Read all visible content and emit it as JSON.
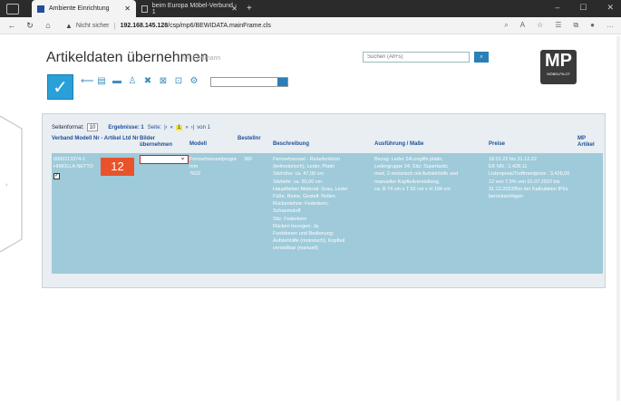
{
  "browser": {
    "tabs": [
      {
        "label": "Ambiente Einrichtung"
      },
      {
        "label": "beim Europa Möbel-Verbund - 1"
      }
    ],
    "address": {
      "security": "Nicht sicher",
      "url_host": "192.168.145.128",
      "url_path": "/csp/mp6/BEWIDATA.mainFrame.cls"
    }
  },
  "header": {
    "title": "Artikeldaten übernehmen",
    "user": "Uli Flottmann",
    "search_placeholder": "Suchen (Alt+s)",
    "logo_text": "MP",
    "logo_sub": "MÖBELPILOT"
  },
  "pager": {
    "per_page_label": "Seitenformat:",
    "per_page_value": "10",
    "results_label": "Ergebnisse: 1",
    "page_label": "Seite:",
    "current_page": "1",
    "of_pages": "von 1"
  },
  "table": {
    "headers": {
      "col1": "Verband Modell Nr - Artikel Ltd Nr",
      "col2": "Bilder übernehmen",
      "col3": "Modell",
      "col4": "Bestellnr",
      "col5": "Beschreibung",
      "col6": "Ausführung / Maße",
      "col7": "Preise",
      "col8": "MP Artikel"
    },
    "row": {
      "id": "0000113374-1",
      "supplier": "HIMOLLA NETTO",
      "step_badge": "12",
      "modell": [
        "Fernsehsesselprogra",
        "mm",
        "7622"
      ],
      "bestellnr": "36F",
      "beschreibung": [
        "Fernsehsessel - Relaxfunktion",
        "(teilmotorisch), Leder, Platin",
        "Sitzhöhe: ca. 47,00 cm",
        "Sitztiefe: ca. 50,00 cm",
        "Hauptfarbe/-Material: Grau, Leder",
        "Füße, Beine, Gestell: Rollen",
        "Rückenlehne: Federkern,",
        "Schaumstoff",
        "Sitz: Federkern",
        "Rücken bezogen: Ja",
        "Funktionen und Bedienung:",
        "Aufstehhilfe (motorisch), Kopfteil",
        "verstellbar (manuell)"
      ],
      "ausfuehrung": [
        "Bezug: Leder 24Longlife platin,",
        "Ledergruppe 24, Sitz: Superlastic",
        "med, 2-motorisch mit Aufstehhilfe und",
        "manueller Kopfteilverstellung,",
        "ca. B 74 cm x T 92 cm x H 104 cm"
      ],
      "preise": [
        "18.01.22 bis 31.12.22",
        "EK NN : 1.428,11",
        "Listenpreis/Treffmentpreis : 3.428,00",
        "12 von 7,5% von 01.07.2022 bis",
        "31.12.2022/Bei der Kalkulation IPI/s",
        "berücksichtigen"
      ]
    }
  }
}
